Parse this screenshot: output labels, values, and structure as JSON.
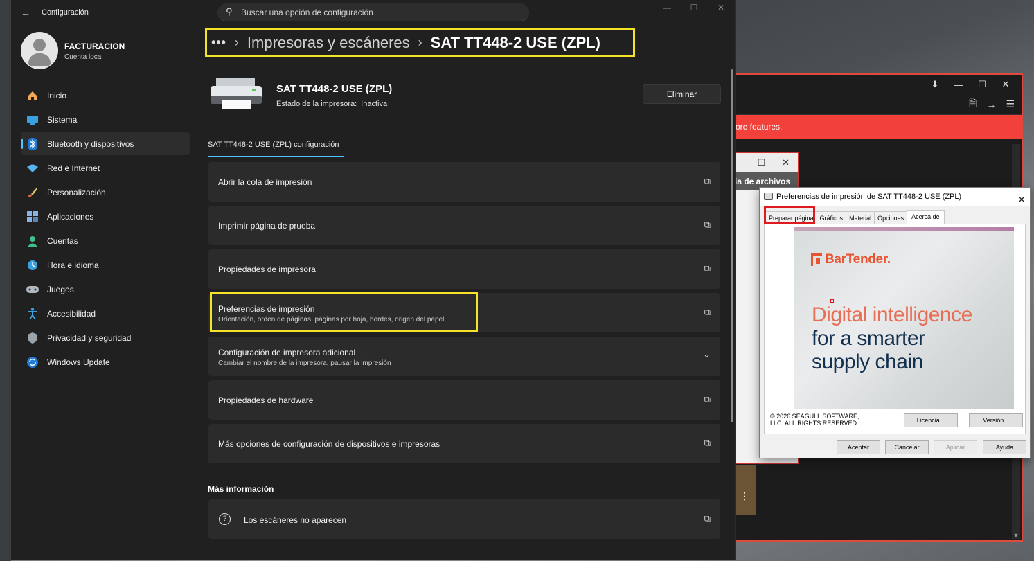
{
  "app": {
    "title": "Configuración"
  },
  "search": {
    "placeholder": "Buscar una opción de configuración"
  },
  "window_controls": {
    "minimize": "—",
    "maximize": "☐",
    "close": "✕"
  },
  "user": {
    "name": "FACTURACION",
    "account_type": "Cuenta local"
  },
  "nav": {
    "items": [
      {
        "label": "Inicio",
        "icon": "home-icon"
      },
      {
        "label": "Sistema",
        "icon": "monitor-icon"
      },
      {
        "label": "Bluetooth y dispositivos",
        "icon": "bluetooth-icon"
      },
      {
        "label": "Red e Internet",
        "icon": "wifi-icon"
      },
      {
        "label": "Personalización",
        "icon": "brush-icon"
      },
      {
        "label": "Aplicaciones",
        "icon": "apps-icon"
      },
      {
        "label": "Cuentas",
        "icon": "person-icon"
      },
      {
        "label": "Hora e idioma",
        "icon": "clock-globe-icon"
      },
      {
        "label": "Juegos",
        "icon": "gamepad-icon"
      },
      {
        "label": "Accesibilidad",
        "icon": "accessibility-icon"
      },
      {
        "label": "Privacidad y seguridad",
        "icon": "shield-icon"
      },
      {
        "label": "Windows Update",
        "icon": "update-icon"
      }
    ],
    "active_index": 2
  },
  "breadcrumb": {
    "dots": "•••",
    "parent": "Impresoras y escáneres",
    "current": "SAT TT448-2 USE (ZPL)"
  },
  "printer": {
    "name": "SAT TT448-2 USE (ZPL)",
    "status_label": "Estado de la impresora:",
    "status_value": "Inactiva",
    "remove_label": "Eliminar"
  },
  "tab": {
    "label": "SAT TT448-2 USE (ZPL) configuración"
  },
  "cards": [
    {
      "title": "Abrir la cola de impresión"
    },
    {
      "title": "Imprimir página de prueba"
    },
    {
      "title": "Propiedades de impresora"
    },
    {
      "title": "Preferencias de impresión",
      "subtitle": "Orientación, orden de páginas, páginas por hoja, bordes, origen del papel"
    },
    {
      "title": "Configuración de impresora adicional",
      "subtitle": "Cambiar el nombre de la impresora, pausar la impresión"
    },
    {
      "title": "Propiedades de hardware"
    },
    {
      "title": "Más opciones de configuración de dispositivos e impresoras"
    }
  ],
  "more_info": {
    "heading": "Más información",
    "scanners": "Los escáneres no aparecen"
  },
  "background_app": {
    "banner_text": "ore features.",
    "dialog_header": "ia de archivos"
  },
  "dialog": {
    "title": "Preferencias de impresión de SAT TT448-2 USE (ZPL)",
    "tabs": [
      "Preparar página",
      "Gráficos",
      "Material",
      "Opciones",
      "Acerca de"
    ],
    "active_tab": "Acerca de",
    "banner": {
      "brand": "BarTender.",
      "line1": "Digital intelligence",
      "line2": "for a smarter",
      "line3": "supply chain"
    },
    "copyright": "© 2026 SEAGULL SOFTWARE, LLC. ALL RIGHTS RESERVED.",
    "buttons": {
      "license": "Licencia...",
      "version": "Versión...",
      "ok": "Aceptar",
      "cancel": "Cancelar",
      "apply": "Aplicar",
      "help": "Ayuda"
    }
  },
  "colors": {
    "accent": "#4cc2ff",
    "highlight_yellow": "#f5e32a",
    "highlight_red": "#e0191f",
    "banner_red": "#f2413b",
    "bartender_orange": "#e8542f"
  }
}
